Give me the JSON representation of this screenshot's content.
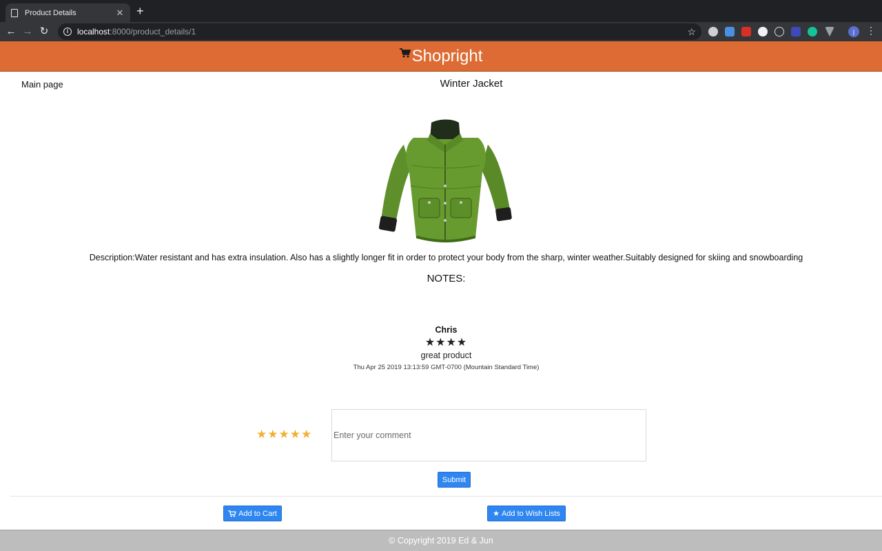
{
  "browser": {
    "tab_title": "Product Details",
    "url_host": "localhost",
    "url_rest": ":8000/product_details/1",
    "profile_initial": "j"
  },
  "header": {
    "brand": "Shopright"
  },
  "nav": {
    "main_page": "Main page"
  },
  "product": {
    "title": "Winter Jacket",
    "description": "Description:Water resistant and has extra insulation. Also has a slightly longer fit in order to protect your body from the sharp, winter weather.Suitably designed for skiing and snowboarding",
    "notes_label": "NOTES:"
  },
  "reviews": [
    {
      "name": "Chris",
      "rating": 4,
      "comment": "great product",
      "date": "Thu Apr 25 2019 13:13:59 GMT-0700 (Mountain Standard Time)"
    }
  ],
  "review_form": {
    "rating": 5,
    "placeholder": "Enter your comment",
    "submit_label": "Submit"
  },
  "actions": {
    "add_to_cart": "Add to Cart",
    "add_to_wish": "Add to Wish Lists"
  },
  "footer": {
    "text": "© Copyright 2019 Ed & Jun"
  },
  "colors": {
    "header_bg": "#dd6b33",
    "button_bg": "#2f86f0",
    "star_filled": "#f0b132",
    "footer_bg": "#bdbdbd"
  }
}
